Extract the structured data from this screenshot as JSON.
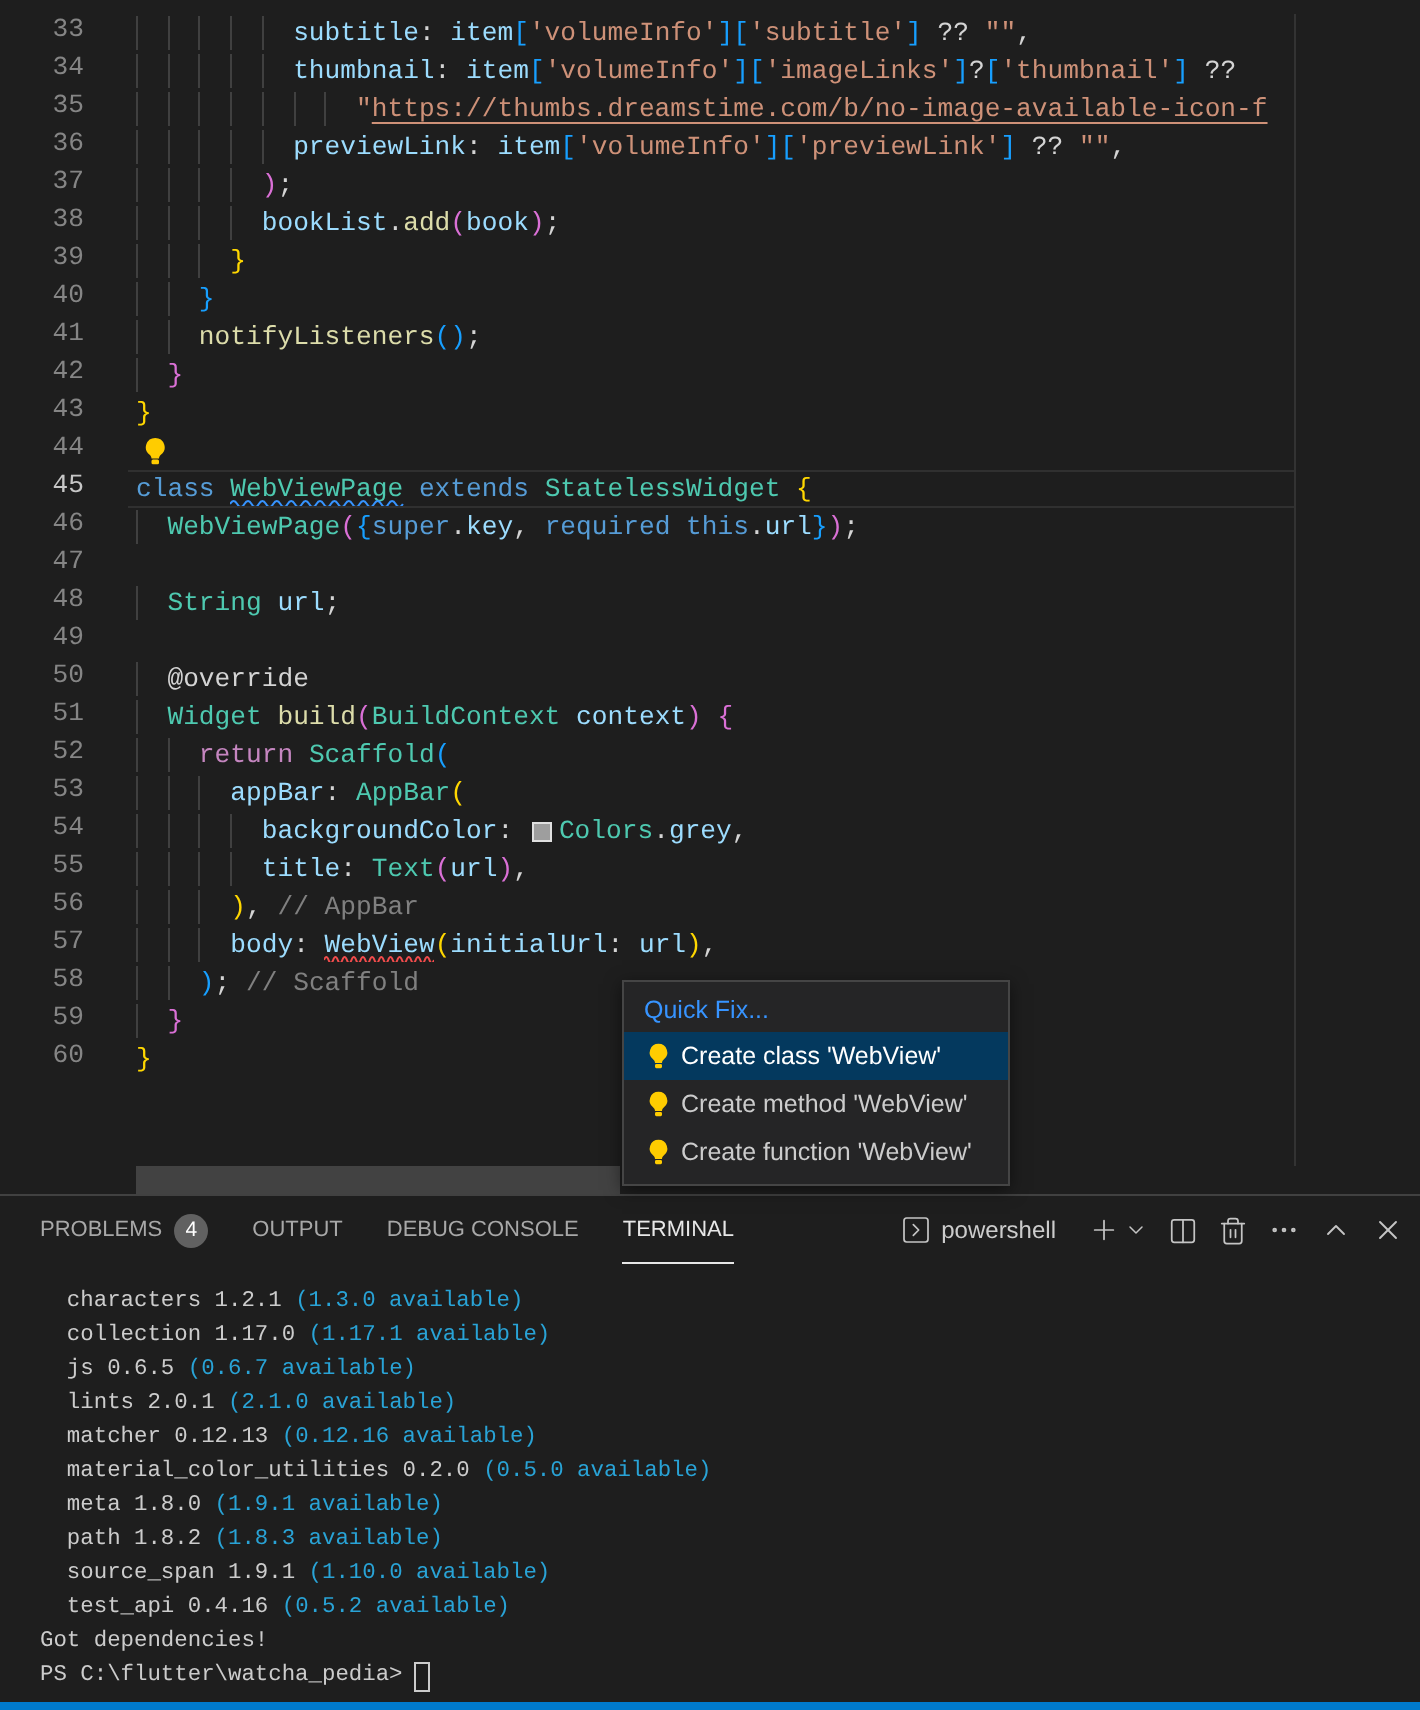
{
  "editor": {
    "lines": [
      {
        "number": "33",
        "tokens": [
          {
            "text": "          subtitle",
            "kind": "var"
          },
          {
            "text": ": ",
            "kind": "plain"
          },
          {
            "text": "item",
            "kind": "var"
          },
          {
            "text": "[",
            "kind": "b3"
          },
          {
            "text": "'volumeInfo'",
            "kind": "str"
          },
          {
            "text": "][",
            "kind": "b3"
          },
          {
            "text": "'subtitle'",
            "kind": "str"
          },
          {
            "text": "]",
            "kind": "b3"
          },
          {
            "text": " ?? ",
            "kind": "plain"
          },
          {
            "text": "\"\"",
            "kind": "str"
          },
          {
            "text": ",",
            "kind": "plain"
          }
        ]
      },
      {
        "number": "34",
        "tokens": [
          {
            "text": "          thumbnail",
            "kind": "var"
          },
          {
            "text": ": ",
            "kind": "plain"
          },
          {
            "text": "item",
            "kind": "var"
          },
          {
            "text": "[",
            "kind": "b3"
          },
          {
            "text": "'volumeInfo'",
            "kind": "str"
          },
          {
            "text": "][",
            "kind": "b3"
          },
          {
            "text": "'imageLinks'",
            "kind": "str"
          },
          {
            "text": "]",
            "kind": "b3"
          },
          {
            "text": "?",
            "kind": "plain"
          },
          {
            "text": "[",
            "kind": "b3"
          },
          {
            "text": "'thumbnail'",
            "kind": "str"
          },
          {
            "text": "]",
            "kind": "b3"
          },
          {
            "text": " ??",
            "kind": "plain"
          }
        ]
      },
      {
        "number": "35",
        "tokens": [
          {
            "text": "              \"",
            "kind": "str"
          },
          {
            "text": "https://thumbs.dreamstime.com/b/no-image-available-icon-f",
            "kind": "link"
          }
        ]
      },
      {
        "number": "36",
        "tokens": [
          {
            "text": "          previewLink",
            "kind": "var"
          },
          {
            "text": ": ",
            "kind": "plain"
          },
          {
            "text": "item",
            "kind": "var"
          },
          {
            "text": "[",
            "kind": "b3"
          },
          {
            "text": "'volumeInfo'",
            "kind": "str"
          },
          {
            "text": "][",
            "kind": "b3"
          },
          {
            "text": "'previewLink'",
            "kind": "str"
          },
          {
            "text": "]",
            "kind": "b3"
          },
          {
            "text": " ?? ",
            "kind": "plain"
          },
          {
            "text": "\"\"",
            "kind": "str"
          },
          {
            "text": ",",
            "kind": "plain"
          }
        ]
      },
      {
        "number": "37",
        "tokens": [
          {
            "text": "        )",
            "kind": "b2"
          },
          {
            "text": ";",
            "kind": "plain"
          }
        ]
      },
      {
        "number": "38",
        "tokens": [
          {
            "text": "        bookList",
            "kind": "var"
          },
          {
            "text": ".",
            "kind": "plain"
          },
          {
            "text": "add",
            "kind": "fn"
          },
          {
            "text": "(",
            "kind": "b2"
          },
          {
            "text": "book",
            "kind": "var"
          },
          {
            "text": ")",
            "kind": "b2"
          },
          {
            "text": ";",
            "kind": "plain"
          }
        ]
      },
      {
        "number": "39",
        "tokens": [
          {
            "text": "      }",
            "kind": "b1"
          }
        ]
      },
      {
        "number": "40",
        "tokens": [
          {
            "text": "    }",
            "kind": "b3"
          }
        ]
      },
      {
        "number": "41",
        "tokens": [
          {
            "text": "    notifyListeners",
            "kind": "fn"
          },
          {
            "text": "()",
            "kind": "b3"
          },
          {
            "text": ";",
            "kind": "plain"
          }
        ]
      },
      {
        "number": "42",
        "tokens": [
          {
            "text": "  }",
            "kind": "b2"
          }
        ]
      },
      {
        "number": "43",
        "tokens": [
          {
            "text": "}",
            "kind": "b1"
          }
        ]
      },
      {
        "number": "44",
        "lightbulb": true
      },
      {
        "number": "45",
        "current": true,
        "tokens": [
          {
            "text": "class ",
            "kind": "kw"
          },
          {
            "text": "WebViewPage",
            "kind": "type",
            "squiggle": {
              "color": "#3794ff"
            }
          },
          {
            "text": " extends ",
            "kind": "kw"
          },
          {
            "text": "StatelessWidget ",
            "kind": "type"
          },
          {
            "text": "{",
            "kind": "b1"
          }
        ]
      },
      {
        "number": "46",
        "tokens": [
          {
            "text": "  WebViewPage",
            "kind": "type"
          },
          {
            "text": "(",
            "kind": "b2"
          },
          {
            "text": "{",
            "kind": "b3"
          },
          {
            "text": "super",
            "kind": "kw"
          },
          {
            "text": ".",
            "kind": "plain"
          },
          {
            "text": "key",
            "kind": "var"
          },
          {
            "text": ", ",
            "kind": "plain"
          },
          {
            "text": "required this",
            "kind": "kw"
          },
          {
            "text": ".",
            "kind": "plain"
          },
          {
            "text": "url",
            "kind": "var"
          },
          {
            "text": "}",
            "kind": "b3"
          },
          {
            "text": ")",
            "kind": "b2"
          },
          {
            "text": ";",
            "kind": "plain"
          }
        ]
      },
      {
        "number": "47"
      },
      {
        "number": "48",
        "tokens": [
          {
            "text": "  String ",
            "kind": "type"
          },
          {
            "text": "url",
            "kind": "var"
          },
          {
            "text": ";",
            "kind": "plain"
          }
        ]
      },
      {
        "number": "49"
      },
      {
        "number": "50",
        "tokens": [
          {
            "text": "  @override",
            "kind": "plain"
          }
        ]
      },
      {
        "number": "51",
        "tokens": [
          {
            "text": "  Widget ",
            "kind": "type"
          },
          {
            "text": "build",
            "kind": "fn"
          },
          {
            "text": "(",
            "kind": "b2"
          },
          {
            "text": "BuildContext ",
            "kind": "type"
          },
          {
            "text": "context",
            "kind": "var"
          },
          {
            "text": ")",
            "kind": "b2"
          },
          {
            "text": " {",
            "kind": "b2"
          }
        ]
      },
      {
        "number": "52",
        "tokens": [
          {
            "text": "    return ",
            "kind": "ctrl"
          },
          {
            "text": "Scaffold",
            "kind": "type"
          },
          {
            "text": "(",
            "kind": "b3"
          }
        ]
      },
      {
        "number": "53",
        "tokens": [
          {
            "text": "      appBar",
            "kind": "var"
          },
          {
            "text": ": ",
            "kind": "plain"
          },
          {
            "text": "AppBar",
            "kind": "type"
          },
          {
            "text": "(",
            "kind": "b1"
          }
        ]
      },
      {
        "number": "54",
        "tokens": [
          {
            "text": "        backgroundColor",
            "kind": "var"
          },
          {
            "text": ": ",
            "kind": "plain"
          },
          {
            "kind": "swatch",
            "color": "#9e9e9e"
          },
          {
            "text": "Colors",
            "kind": "type"
          },
          {
            "text": ".",
            "kind": "plain"
          },
          {
            "text": "grey",
            "kind": "var"
          },
          {
            "text": ",",
            "kind": "plain"
          }
        ]
      },
      {
        "number": "55",
        "tokens": [
          {
            "text": "        title",
            "kind": "var"
          },
          {
            "text": ": ",
            "kind": "plain"
          },
          {
            "text": "Text",
            "kind": "type"
          },
          {
            "text": "(",
            "kind": "b2"
          },
          {
            "text": "url",
            "kind": "var"
          },
          {
            "text": ")",
            "kind": "b2"
          },
          {
            "text": ",",
            "kind": "plain"
          }
        ]
      },
      {
        "number": "56",
        "tokens": [
          {
            "text": "      )",
            "kind": "b1"
          },
          {
            "text": ", ",
            "kind": "plain"
          },
          {
            "text": "// AppBar",
            "kind": "comment"
          }
        ]
      },
      {
        "number": "57",
        "tokens": [
          {
            "text": "      body",
            "kind": "var"
          },
          {
            "text": ": ",
            "kind": "plain"
          },
          {
            "text": "WebView",
            "kind": "var",
            "squiggle": {
              "color": "#f14c4c"
            }
          },
          {
            "text": "(",
            "kind": "b1"
          },
          {
            "text": "initialUrl",
            "kind": "var"
          },
          {
            "text": ": ",
            "kind": "plain"
          },
          {
            "text": "url",
            "kind": "var"
          },
          {
            "text": ")",
            "kind": "b1"
          },
          {
            "text": ",",
            "kind": "plain"
          }
        ]
      },
      {
        "number": "58",
        "tokens": [
          {
            "text": "    )",
            "kind": "b3"
          },
          {
            "text": "; ",
            "kind": "plain"
          },
          {
            "text": "// Scaffold",
            "kind": "comment"
          }
        ]
      },
      {
        "number": "59",
        "tokens": [
          {
            "text": "  }",
            "kind": "b2"
          }
        ]
      },
      {
        "number": "60",
        "tokens": [
          {
            "text": "}",
            "kind": "b1"
          }
        ]
      }
    ]
  },
  "quick_fix": {
    "title": "Quick Fix...",
    "items": [
      {
        "label": "Create class 'WebView'",
        "selected": true
      },
      {
        "label": "Create method 'WebView'",
        "selected": false
      },
      {
        "label": "Create function 'WebView'",
        "selected": false
      }
    ]
  },
  "panel": {
    "tabs": [
      {
        "label": "PROBLEMS",
        "badge": "4",
        "selected": false
      },
      {
        "label": "OUTPUT",
        "selected": false
      },
      {
        "label": "DEBUG CONSOLE",
        "selected": false
      },
      {
        "label": "TERMINAL",
        "selected": true
      }
    ],
    "shell": "powershell"
  },
  "terminal": {
    "packages": [
      {
        "text": "characters 1.2.1",
        "note": "(1.3.0 available)"
      },
      {
        "text": "collection 1.17.0",
        "note": "(1.17.1 available)"
      },
      {
        "text": "js 0.6.5",
        "note": "(0.6.7 available)"
      },
      {
        "text": "lints 2.0.1",
        "note": "(2.1.0 available)"
      },
      {
        "text": "matcher 0.12.13",
        "note": "(0.12.16 available)"
      },
      {
        "text": "material_color_utilities 0.2.0",
        "note": "(0.5.0 available)"
      },
      {
        "text": "meta 1.8.0",
        "note": "(1.9.1 available)"
      },
      {
        "text": "path 1.8.2",
        "note": "(1.8.3 available)"
      },
      {
        "text": "source_span 1.9.1",
        "note": "(1.10.0 available)"
      },
      {
        "text": "test_api 0.4.16",
        "note": "(0.5.2 available)"
      }
    ],
    "message": "Got dependencies!",
    "prompt": "PS C:\\flutter\\watcha_pedia>"
  }
}
